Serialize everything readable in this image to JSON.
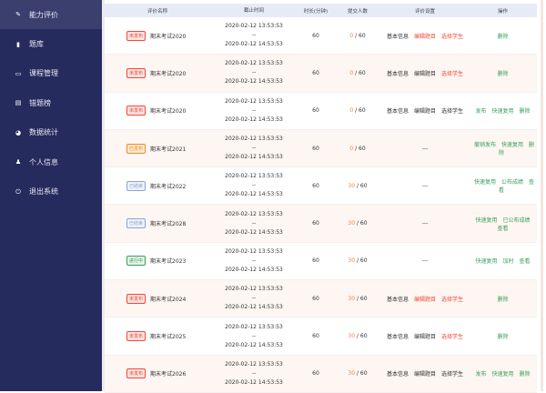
{
  "colors": {
    "sidebar": "#262b5e",
    "active": "#3a3f6e",
    "red": "#f24a3a",
    "green": "#3a9e5c",
    "orange": "#f2804a",
    "dark": "#333"
  },
  "sidebar": {
    "items": [
      {
        "label": "能力评价",
        "icon": "pencil-icon",
        "active": true
      },
      {
        "label": "题库",
        "icon": "book-icon"
      },
      {
        "label": "课程管理",
        "icon": "monitor-icon"
      },
      {
        "label": "错题榜",
        "icon": "document-icon"
      },
      {
        "label": "数据统计",
        "icon": "pie-chart-icon"
      },
      {
        "label": "个人信息",
        "icon": "user-icon"
      },
      {
        "label": "退出系统",
        "icon": "power-icon"
      }
    ]
  },
  "table": {
    "headers": [
      "评价名称",
      "截止时间",
      "时长(分钟)",
      "提交人数",
      "评价设置",
      "操作"
    ],
    "rows": [
      {
        "status": "未发布",
        "tone": "red",
        "name": "期末考试2020",
        "start": "2020-02-12 13:53:53",
        "sep": "--",
        "end": "2020-02-12 14:53:53",
        "duration": "60",
        "submitted": "0",
        "total": "/ 60",
        "settings": [
          [
            "基本信息",
            "dark"
          ],
          [
            "编辑题目",
            "red"
          ],
          [
            "选择学生",
            "red"
          ]
        ],
        "ops": [
          "删除"
        ]
      },
      {
        "status": "未发布",
        "tone": "red",
        "name": "期末考试2020",
        "start": "2020-02-12 13:53:53",
        "sep": "--",
        "end": "2020-02-12 14:53:53",
        "duration": "60",
        "submitted": "0",
        "total": "/ 60",
        "settings": [
          [
            "基本信息",
            "dark"
          ],
          [
            "编辑题目",
            "dark"
          ],
          [
            "选择学生",
            "red"
          ]
        ],
        "ops": [
          "删除"
        ]
      },
      {
        "status": "未发布",
        "tone": "red",
        "name": "期末考试2020",
        "start": "2020-02-12 13:53:53",
        "sep": "--",
        "end": "2020-02-12 14:53:53",
        "duration": "60",
        "submitted": "0",
        "total": "/ 60",
        "settings": [
          [
            "基本信息",
            "dark"
          ],
          [
            "编辑题目",
            "dark"
          ],
          [
            "选择学生",
            "dark"
          ]
        ],
        "ops": [
          "发布",
          "快速复用",
          "删除"
        ]
      },
      {
        "status": "已发布",
        "tone": "orange",
        "name": "期末考试2021",
        "start": "2020-02-12 13:53:53",
        "sep": "--",
        "end": "2020-02-12 14:53:53",
        "duration": "60",
        "submitted": "0",
        "total": "/ 60",
        "settings_text": "---",
        "ops": [
          "撤销发布",
          "快速复用",
          "删除"
        ]
      },
      {
        "status": "已结束",
        "tone": "blue",
        "name": "期末考试2022",
        "start": "2020-02-12 13:53:53",
        "sep": "--",
        "end": "2020-02-12 14:53:53",
        "duration": "60",
        "submitted": "30",
        "total": "/ 60",
        "settings_text": "---",
        "ops": [
          "快速复用",
          "公布成绩",
          "查看"
        ]
      },
      {
        "status": "已结束",
        "tone": "blue",
        "name": "期末考试2028",
        "start": "2020-02-12 13:53:53",
        "sep": "--",
        "end": "2020-02-12 14:53:53",
        "duration": "60",
        "submitted": "30",
        "total": "/ 60",
        "settings_text": "---",
        "ops": [
          "快速复用",
          "已公布成绩",
          "查看"
        ]
      },
      {
        "status": "进行中",
        "tone": "green",
        "name": "期末考试2023",
        "start": "2020-02-12 13:53:53",
        "sep": "--",
        "end": "2020-02-12 14:53:53",
        "duration": "60",
        "submitted": "30",
        "total": "/ 60",
        "settings_text": "---",
        "ops": [
          "快速复用",
          "加时",
          "查看"
        ]
      },
      {
        "status": "未发布",
        "tone": "red",
        "name": "期末考试2024",
        "start": "2020-02-12 13:53:53",
        "sep": "--",
        "end": "2020-02-12 14:53:53",
        "duration": "60",
        "submitted": "30",
        "total": "/ 60",
        "settings": [
          [
            "基本信息",
            "dark"
          ],
          [
            "编辑题目",
            "red"
          ],
          [
            "选择学生",
            "red"
          ]
        ],
        "ops": [
          "删除"
        ]
      },
      {
        "status": "未发布",
        "tone": "red",
        "name": "期末考试2025",
        "start": "2020-02-12 13:53:53",
        "sep": "--",
        "end": "2020-02-12 14:53:53",
        "duration": "60",
        "submitted": "30",
        "total": "/ 60",
        "settings": [
          [
            "基本信息",
            "dark"
          ],
          [
            "编辑题目",
            "dark"
          ],
          [
            "选择学生",
            "red"
          ]
        ],
        "ops": [
          "删除"
        ]
      },
      {
        "status": "未发布",
        "tone": "red",
        "name": "期末考试2026",
        "start": "2020-02-12 13:53:53",
        "sep": "--",
        "end": "2020-02-12 14:53:53",
        "duration": "60",
        "submitted": "30",
        "total": "/ 60",
        "settings": [
          [
            "基本信息",
            "dark"
          ],
          [
            "编辑题目",
            "dark"
          ],
          [
            "选择学生",
            "dark"
          ]
        ],
        "ops": [
          "发布",
          "快速复用",
          "删除"
        ]
      }
    ]
  }
}
